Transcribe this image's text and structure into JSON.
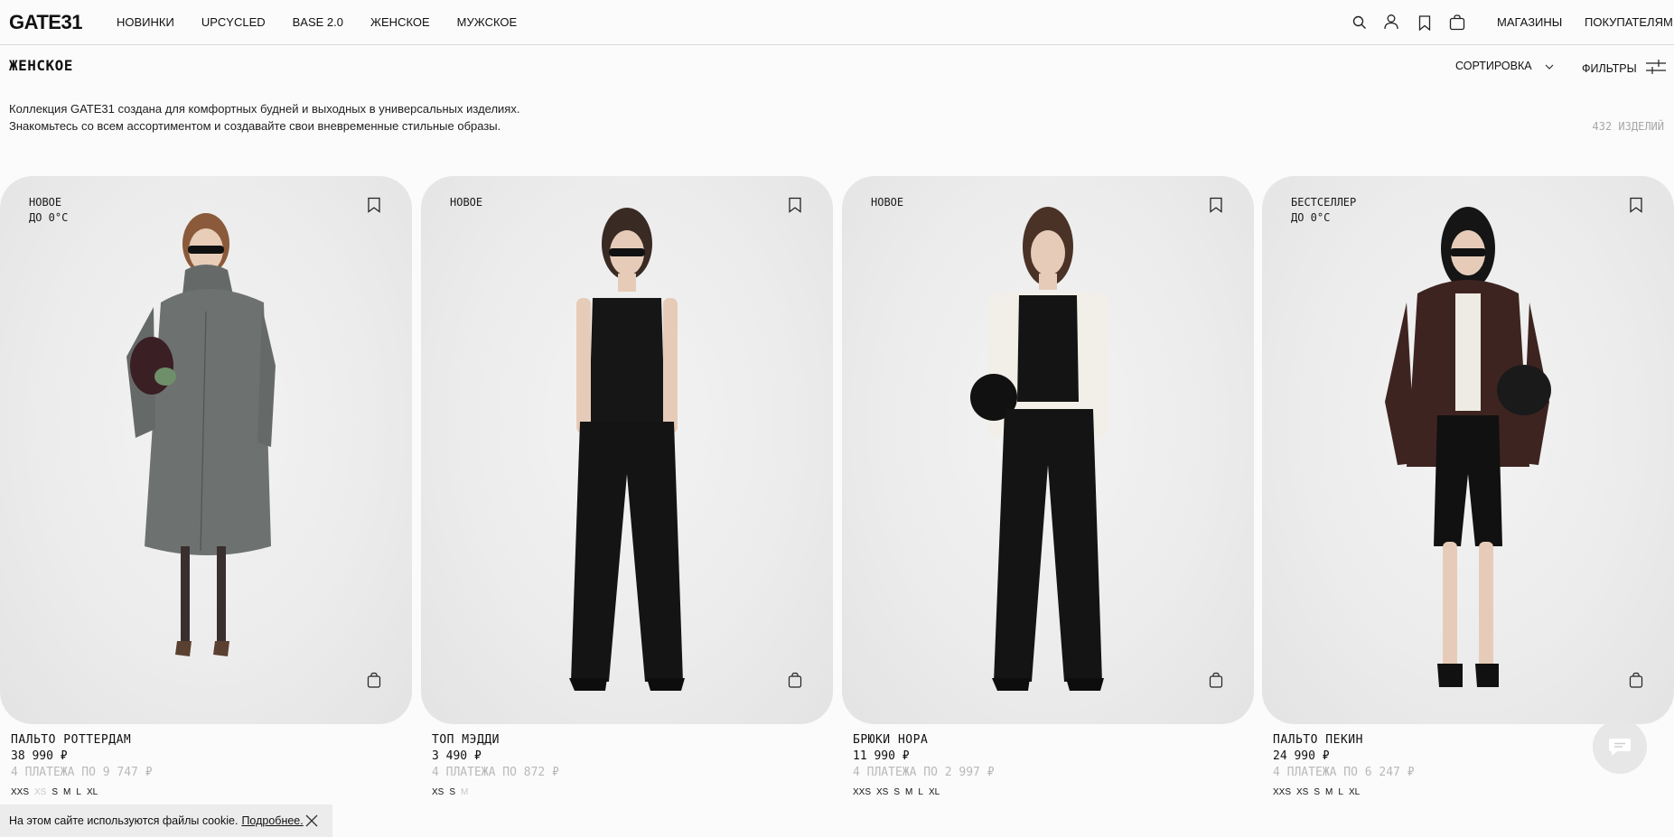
{
  "header": {
    "logo": "GATE31",
    "nav": [
      "НОВИНКИ",
      "UPCYCLED",
      "BASE 2.0",
      "ЖЕНСКОЕ",
      "МУЖСКОЕ"
    ],
    "icons": [
      "search-icon",
      "account-icon",
      "bookmark-icon",
      "bag-icon"
    ],
    "stores": "МАГАЗИНЫ",
    "buyers": "ПОКУПАТЕЛЯМ"
  },
  "page": {
    "title": "ЖЕНСКОЕ",
    "sort_label": "СОРТИРОВКА",
    "filters_label": "ФИЛЬТРЫ",
    "description_line1": "Коллекция GATE31 создана для комфортных будней и выходных в универсальных изделиях.",
    "description_line2": "Знакомьтесь со всем ассортиментом и создавайте свои вневременные стильные образы.",
    "count": "432 ИЗДЕЛИЙ"
  },
  "products": [
    {
      "badge1": "НОВОЕ",
      "badge2": "ДО 0°С",
      "name": "ПАЛЬТО РОТТЕРДАМ",
      "price": "38 990 ₽",
      "installment": "4 ПЛАТЕЖА ПО 9 747 ₽",
      "sizes": [
        {
          "s": "XXS",
          "a": true
        },
        {
          "s": "XS",
          "a": false
        },
        {
          "s": "S",
          "a": true
        },
        {
          "s": "M",
          "a": true
        },
        {
          "s": "L",
          "a": true
        },
        {
          "s": "XL",
          "a": true
        }
      ]
    },
    {
      "badge1": "НОВОЕ",
      "badge2": "",
      "name": "ТОП МЭДДИ",
      "price": "3 490 ₽",
      "installment": "4 ПЛАТЕЖА ПО 872 ₽",
      "sizes": [
        {
          "s": "XS",
          "a": true
        },
        {
          "s": "S",
          "a": true
        },
        {
          "s": "M",
          "a": false
        }
      ]
    },
    {
      "badge1": "НОВОЕ",
      "badge2": "",
      "name": "БРЮКИ НОРА",
      "price": "11 990 ₽",
      "installment": "4 ПЛАТЕЖА ПО 2 997 ₽",
      "sizes": [
        {
          "s": "XXS",
          "a": true
        },
        {
          "s": "XS",
          "a": true
        },
        {
          "s": "S",
          "a": true
        },
        {
          "s": "M",
          "a": true
        },
        {
          "s": "L",
          "a": true
        },
        {
          "s": "XL",
          "a": true
        }
      ]
    },
    {
      "badge1": "БЕСТСЕЛЛЕР",
      "badge2": "ДО 0°С",
      "name": "ПАЛЬТО ПЕКИН",
      "price": "24 990 ₽",
      "installment": "4 ПЛАТЕЖА ПО 6 247 ₽",
      "sizes": [
        {
          "s": "XXS",
          "a": true
        },
        {
          "s": "XS",
          "a": true
        },
        {
          "s": "S",
          "a": true
        },
        {
          "s": "M",
          "a": true
        },
        {
          "s": "L",
          "a": true
        },
        {
          "s": "XL",
          "a": true
        }
      ]
    }
  ],
  "cookie": {
    "text": "На этом сайте используются файлы cookie.",
    "link": "Подробнее."
  },
  "chat_icon": "chat-icon"
}
